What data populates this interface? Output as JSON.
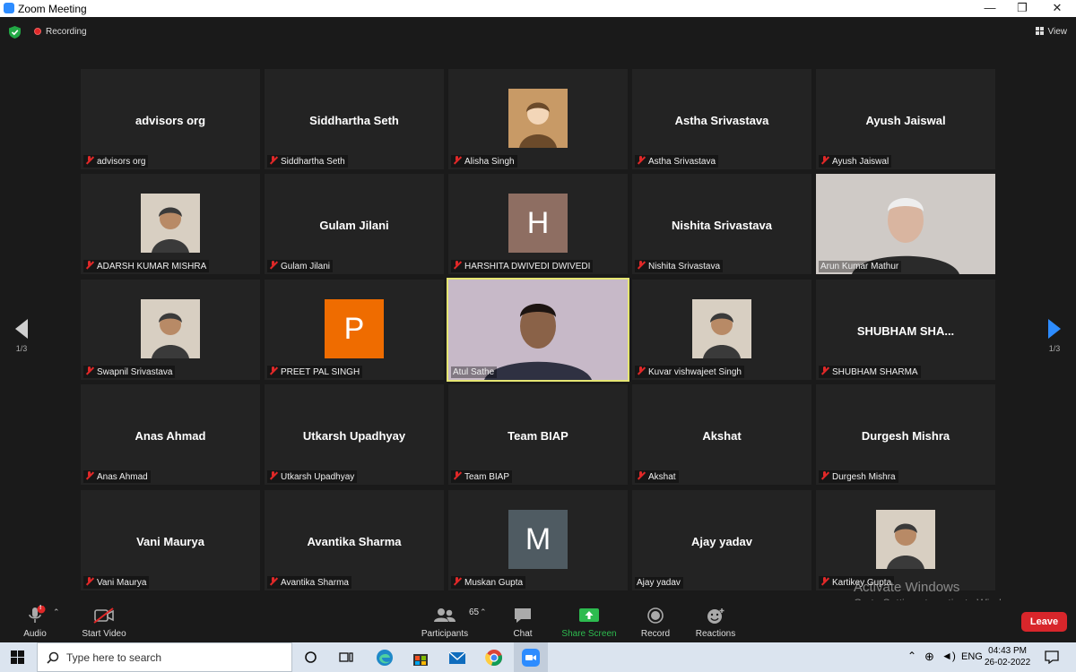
{
  "window": {
    "title": "Zoom Meeting",
    "minimize": "—",
    "restore": "❐",
    "close": "✕"
  },
  "header": {
    "recording": "Recording",
    "view": "View"
  },
  "nav": {
    "page_left": "1/3",
    "page_right": "1/3"
  },
  "tiles": [
    {
      "big": "advisors org",
      "label": "advisors org",
      "muted": true
    },
    {
      "big": "Siddhartha Seth",
      "label": "Siddhartha Seth",
      "muted": true
    },
    {
      "big": "",
      "label": "Alisha Singh",
      "muted": true,
      "avatar": "cartoon-avatar"
    },
    {
      "big": "Astha Srivastava",
      "label": "Astha Srivastava",
      "muted": true
    },
    {
      "big": "Ayush Jaiswal",
      "label": "Ayush Jaiswal",
      "muted": true
    },
    {
      "big": "",
      "label": "ADARSH KUMAR MISHRA",
      "muted": true,
      "avatar": "photo-avatar"
    },
    {
      "big": "Gulam Jilani",
      "label": "Gulam Jilani",
      "muted": true
    },
    {
      "big": "",
      "label": "HARSHITA DWIVEDI DWIVEDI",
      "muted": true,
      "letter": "H",
      "letter_color": "#8e6e62"
    },
    {
      "big": "Nishita Srivastava",
      "label": "Nishita Srivastava",
      "muted": true
    },
    {
      "big": "",
      "label": "Arun Kumar Mathur",
      "muted": false,
      "video": true
    },
    {
      "big": "",
      "label": "Swapnil Srivastava",
      "muted": true,
      "avatar": "photo-avatar"
    },
    {
      "big": "",
      "label": "PREET PAL SINGH",
      "muted": true,
      "letter": "P",
      "letter_color": "#ef6c00"
    },
    {
      "big": "",
      "label": "Atul Sathe",
      "muted": false,
      "video": true,
      "active": true
    },
    {
      "big": "",
      "label": "Kuvar vishwajeet Singh",
      "muted": true,
      "avatar": "photo-avatar"
    },
    {
      "big": "SHUBHAM  SHA...",
      "label": "SHUBHAM SHARMA",
      "muted": true
    },
    {
      "big": "Anas Ahmad",
      "label": "Anas Ahmad",
      "muted": true
    },
    {
      "big": "Utkarsh Upadhyay",
      "label": "Utkarsh Upadhyay",
      "muted": true
    },
    {
      "big": "Team BIAP",
      "label": "Team BIAP",
      "muted": true
    },
    {
      "big": "Akshat",
      "label": "Akshat",
      "muted": true
    },
    {
      "big": "Durgesh Mishra",
      "label": "Durgesh Mishra",
      "muted": true
    },
    {
      "big": "Vani Maurya",
      "label": "Vani Maurya",
      "muted": true
    },
    {
      "big": "Avantika Sharma",
      "label": "Avantika Sharma",
      "muted": true
    },
    {
      "big": "",
      "label": "Muskan Gupta",
      "muted": true,
      "letter": "M",
      "letter_color": "#4f5b62"
    },
    {
      "big": "Ajay yadav",
      "label": "Ajay yadav",
      "muted": false
    },
    {
      "big": "",
      "label": "Kartikey Gupta",
      "muted": true,
      "avatar": "photo-avatar"
    }
  ],
  "toolbar": {
    "audio": "Audio",
    "audio_badge": "!",
    "start_video": "Start Video",
    "participants": "Participants",
    "participants_count": "65",
    "chat": "Chat",
    "share_screen": "Share Screen",
    "record": "Record",
    "reactions": "Reactions",
    "leave": "Leave",
    "share_color": "#2dbb4f"
  },
  "watermark": {
    "title": "Activate Windows",
    "subtitle": "Go to Settings to activate Windows."
  },
  "taskbar": {
    "search_placeholder": "Type here to search",
    "lang": "ENG",
    "time": "04:43 PM",
    "date": "26-02-2022"
  }
}
